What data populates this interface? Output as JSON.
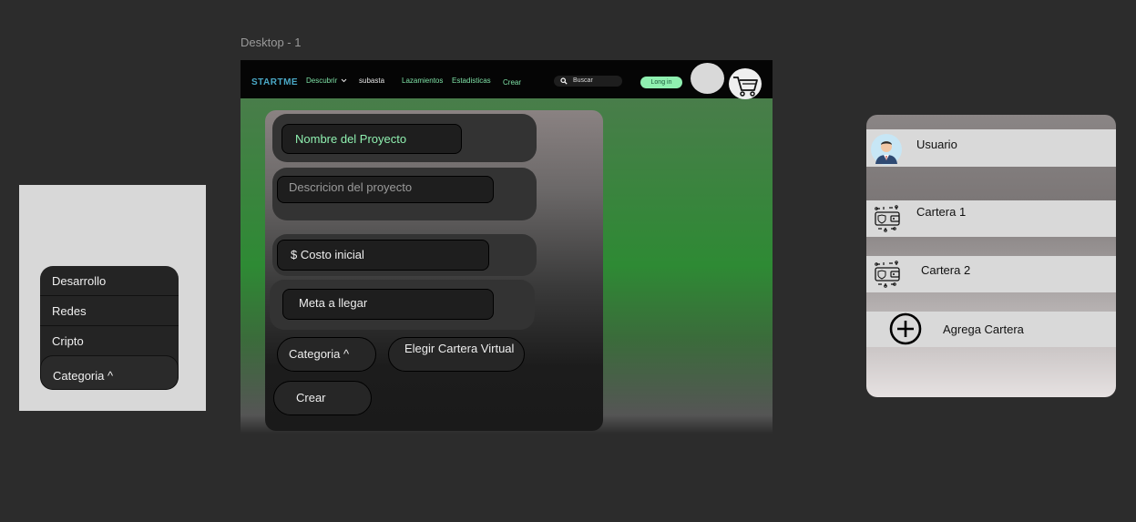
{
  "frame_label": "Desktop - 1",
  "category_menu": {
    "items": [
      "Desarrollo",
      "Redes",
      "Cripto"
    ],
    "toggle": "Categoria ^"
  },
  "navbar": {
    "logo": "STARTME",
    "discover": "Descubrir",
    "auction": "subasta",
    "launches": "Lazamientos",
    "stats": "Estadisticas",
    "create": "Crear",
    "search_placeholder": "Buscar",
    "login": "Long in"
  },
  "form": {
    "project_name": "Nombre del Proyecto",
    "description_placeholder": "Descricion del proyecto",
    "initial_cost": "$ Costo inicial",
    "goal": "Meta a llegar",
    "category_button": "Categoria ^",
    "wallet_button": "Elegir Cartera Virtual",
    "create_button": "Crear"
  },
  "wallet_panel": {
    "user": "Usuario",
    "wallets": [
      "Cartera 1",
      "Cartera 2"
    ],
    "add_wallet": "Agrega Cartera"
  },
  "colors": {
    "canvas": "#2c2c2c",
    "accent_green": "#8ff0b0",
    "nav_green_text": "#7fe3a7",
    "logo_blue": "#4aa8c6"
  }
}
